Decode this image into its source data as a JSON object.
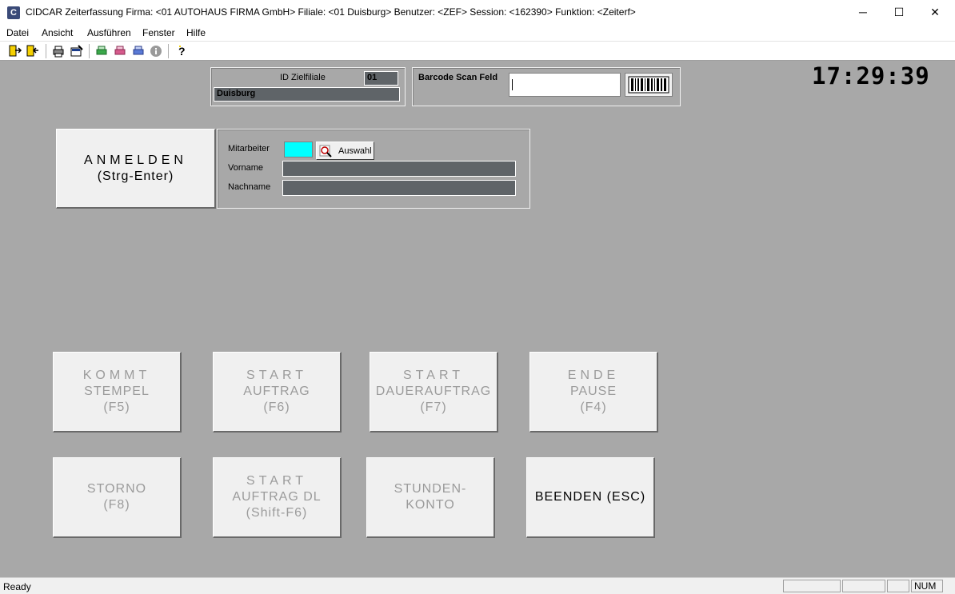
{
  "window": {
    "title": "CIDCAR Zeiterfassung  Firma: <01 AUTOHAUS FIRMA GmbH> Filiale: <01 Duisburg> Benutzer: <ZEF> Session: <162390> Funktion: <Zeiterf>",
    "icon_letter": "C",
    "minimize": "─",
    "maximize": "☐",
    "close": "✕"
  },
  "menu": {
    "items": [
      "Datei",
      "Ansicht",
      "Ausführen",
      "Fenster",
      "Hilfe"
    ]
  },
  "toolbar": {
    "icons": [
      "exit-icon",
      "exit-alt-icon",
      "print-icon",
      "print-preview-icon",
      "print-green-icon",
      "print-pink-icon",
      "print-blue-icon",
      "info-icon",
      "help-icon"
    ]
  },
  "filiale": {
    "id_label": "ID Zielfiliale",
    "id_value": "01",
    "name_value": "Duisburg"
  },
  "barcode": {
    "label": "Barcode Scan Feld",
    "value": ""
  },
  "clock": "17:29:39",
  "login": {
    "button_line1": "ANMELDEN",
    "button_line2": "(Strg-Enter)",
    "mitarbeiter_label": "Mitarbeiter",
    "mitarbeiter_value": "",
    "auswahl_label": "Auswahl",
    "vorname_label": "Vorname",
    "vorname_value": "",
    "nachname_label": "Nachname",
    "nachname_value": ""
  },
  "buttons": {
    "kommt": [
      "KOMMT",
      "STEMPEL",
      "(F5)"
    ],
    "start_auftrag": [
      "START",
      "AUFTRAG",
      "(F6)"
    ],
    "start_dauerauftrag": [
      "START",
      "DAUERAUFTRAG",
      "(F7)"
    ],
    "ende_pause": [
      "ENDE",
      "PAUSE",
      "(F4)"
    ],
    "storno": [
      "STORNO",
      "(F8)"
    ],
    "start_auftrag_dl": [
      "START",
      "AUFTRAG DL",
      "(Shift-F6)"
    ],
    "stundenkonto": [
      "STUNDEN-",
      "KONTO"
    ],
    "beenden": "BEENDEN (ESC)"
  },
  "statusbar": {
    "text": "Ready",
    "num": "NUM"
  },
  "colors": {
    "background": "#a8a8a8",
    "mitarbeiter_field": "#00ffff",
    "dark_field": "#5f6468"
  }
}
